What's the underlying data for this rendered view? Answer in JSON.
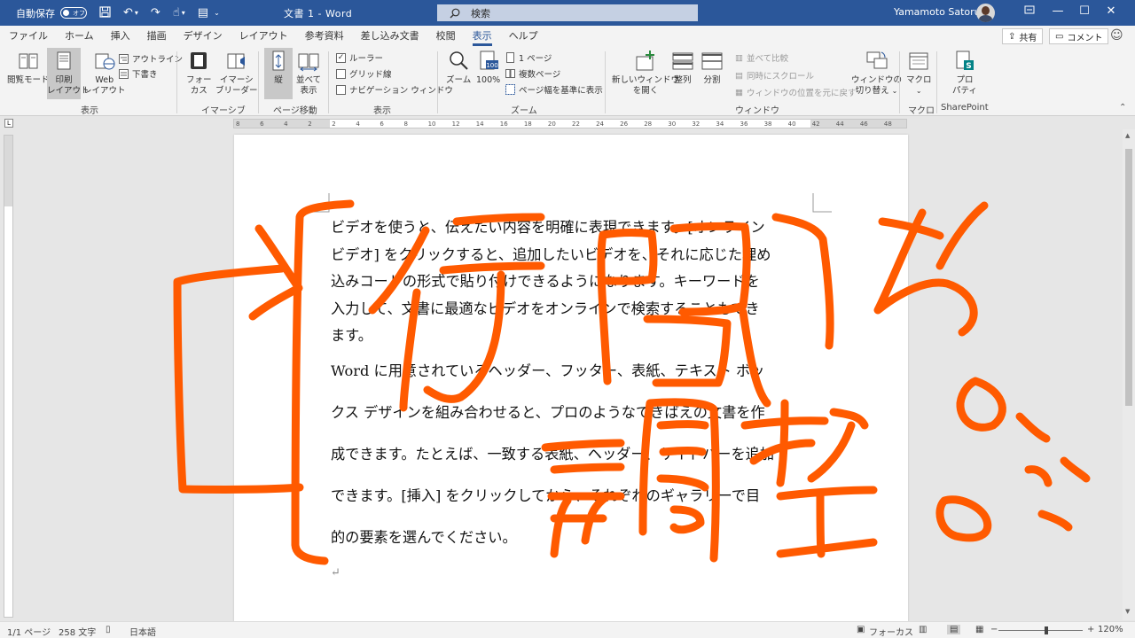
{
  "titlebar": {
    "autosave_label": "自動保存",
    "autosave_state": "オフ",
    "doc_title": "文書 1",
    "title_sep": "-",
    "app_name": "Word",
    "search_placeholder": "検索",
    "user_name": "Yamamoto Satoru"
  },
  "tabs": [
    "ファイル",
    "ホーム",
    "挿入",
    "描画",
    "デザイン",
    "レイアウト",
    "参考資料",
    "差し込み文書",
    "校閲",
    "表示",
    "ヘルプ"
  ],
  "active_tab": "表示",
  "share_label": "共有",
  "comment_label": "コメント",
  "ribbon": {
    "groups": {
      "view": "表示",
      "immersive": "イマーシブ",
      "page_move": "ページ移動",
      "show": "表示",
      "zoom": "ズーム",
      "window": "ウィンドウ",
      "macro": "マクロ",
      "sharepoint": "SharePoint"
    },
    "read_mode": "閲覧モード",
    "print_layout_1": "印刷",
    "print_layout_2": "レイアウト",
    "web_layout_1": "Web",
    "web_layout_2": "レイアウト",
    "outline": "アウトライン",
    "draft": "下書き",
    "focus_1": "フォー",
    "focus_2": "カス",
    "immersive_reader_1": "イマーシ",
    "immersive_reader_2": "ブリーダー",
    "vertical": "縦",
    "side_by_side_1": "並べて",
    "side_by_side_2": "表示",
    "ruler": "ルーラー",
    "gridlines": "グリッド線",
    "navigation_pane": "ナビゲーション ウィンドウ",
    "zoom": "ズーム",
    "zoom_100": "100%",
    "one_page": "1 ページ",
    "multiple_pages": "複数ページ",
    "page_width": "ページ幅を基準に表示",
    "new_window_1": "新しいウィンドウ",
    "new_window_2": "を開く",
    "arrange_all": "整列",
    "split": "分割",
    "view_side_by_side": "並べて比較",
    "sync_scroll": "同時にスクロール",
    "reset_position": "ウィンドウの位置を元に戻す",
    "switch_windows_1": "ウィンドウの",
    "switch_windows_2": "切り替え",
    "macros": "マクロ",
    "properties_1": "プロ",
    "properties_2": "パティ"
  },
  "document": {
    "para1_lines": [
      "ビデオを使うと、伝えたい内容を明確に表現できます。[オンライン",
      "ビデオ] をクリックすると、追加したいビデオを、それに応じた埋め",
      "込みコードの形式で貼り付けできるようになります。キーワードを",
      "入力して、文書に最適なビデオをオンラインで検索することもでき",
      "ます。"
    ],
    "para2_lines": [
      "Word に用意されているヘッダー、フッター、表紙、テキスト ボッ",
      "クス デザインを組み合わせると、プロのようなできばえの文書を作",
      "成できます。たとえば、一致する表紙、ヘッダー、サイドバーを追加",
      "できます。[挿入] をクリックしてから、それぞれのギャラリーで目",
      "的の要素を選んでください。"
    ],
    "paragraph_mark": "↵"
  },
  "statusbar": {
    "page": "1/1 ページ",
    "words": "258 文字",
    "language": "日本語",
    "focus": "フォーカス",
    "zoom": "120%"
  },
  "ruler_ticks": [
    "8",
    "6",
    "4",
    "2",
    "2",
    "4",
    "6",
    "8",
    "10",
    "12",
    "14",
    "16",
    "18",
    "20",
    "22",
    "24",
    "26",
    "28",
    "30",
    "32",
    "34",
    "36",
    "38",
    "40",
    "42",
    "44",
    "46",
    "48"
  ],
  "colors": {
    "title_bar": "#2b579a",
    "ink": "#ff5a00"
  }
}
